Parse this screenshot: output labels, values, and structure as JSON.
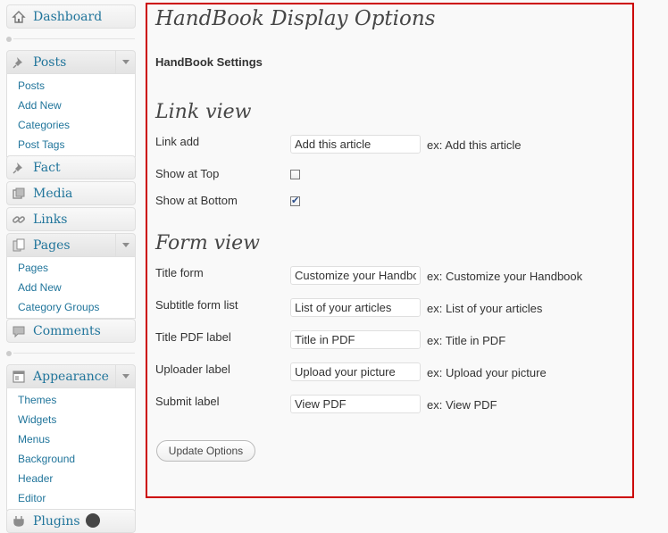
{
  "sidebar": {
    "dashboard": "Dashboard",
    "posts": {
      "label": "Posts",
      "items": [
        "Posts",
        "Add New",
        "Categories",
        "Post Tags"
      ]
    },
    "fact": "Fact",
    "media": "Media",
    "links": "Links",
    "pages": {
      "label": "Pages",
      "items": [
        "Pages",
        "Add New",
        "Category Groups"
      ]
    },
    "comments": "Comments",
    "appearance": {
      "label": "Appearance",
      "items": [
        "Themes",
        "Widgets",
        "Menus",
        "Background",
        "Header",
        "Editor"
      ]
    },
    "plugins": "Plugins"
  },
  "main": {
    "title": "HandBook Display Options",
    "settings_heading": "HandBook Settings",
    "link_view": {
      "heading": "Link view",
      "link_add_label": "Link add",
      "link_add_value": "Add this article",
      "link_add_hint": "ex: Add this article",
      "show_top_label": "Show at Top",
      "show_top_checked": false,
      "show_bottom_label": "Show at Bottom",
      "show_bottom_checked": true
    },
    "form_view": {
      "heading": "Form view",
      "fields": [
        {
          "label": "Title form",
          "value": "Customize your Handbook",
          "hint": "ex: Customize your Handbook"
        },
        {
          "label": "Subtitle form list",
          "value": "List of your articles",
          "hint": "ex: List of your articles"
        },
        {
          "label": "Title PDF label",
          "value": "Title in PDF",
          "hint": "ex: Title in PDF"
        },
        {
          "label": "Uploader label",
          "value": "Upload your picture",
          "hint": "ex: Upload your picture"
        },
        {
          "label": "Submit label",
          "value": "View PDF",
          "hint": "ex: View PDF"
        }
      ]
    },
    "update_button": "Update Options"
  },
  "colors": {
    "link": "#21759b",
    "highlight_border": "#cc0000"
  }
}
